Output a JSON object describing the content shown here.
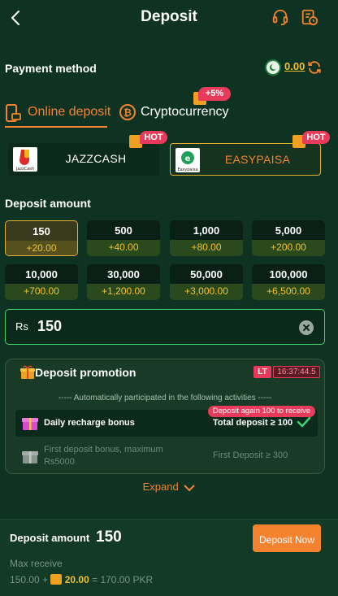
{
  "header": {
    "title": "Deposit",
    "back_icon": "chevron-left-icon",
    "support_icon": "headset-icon",
    "record_icon": "history-icon"
  },
  "payment_method": {
    "label": "Payment method",
    "balance": "0.00",
    "flag_icon": "pakistan-flag-icon",
    "refresh_icon": "refresh-icon"
  },
  "tabs": [
    {
      "label": "Online deposit",
      "icon": "card-phone-icon",
      "active": true
    },
    {
      "label": "Cryptocurrency",
      "icon": "bitcoin-icon",
      "active": false,
      "badge": "+5%"
    }
  ],
  "channels": [
    {
      "name": "JAZZCASH",
      "logo_text": "JazzCash",
      "badge": "HOT",
      "selected": false
    },
    {
      "name": "EASYPAISA",
      "logo_text": "Easypaisa",
      "badge": "HOT",
      "selected": true
    }
  ],
  "deposit_amount": {
    "label": "Deposit amount",
    "options": [
      {
        "amount": "150",
        "bonus": "+20.00",
        "selected": true
      },
      {
        "amount": "500",
        "bonus": "+40.00"
      },
      {
        "amount": "1,000",
        "bonus": "+80.00"
      },
      {
        "amount": "5,000",
        "bonus": "+200.00"
      },
      {
        "amount": "10,000",
        "bonus": "+700.00"
      },
      {
        "amount": "30,000",
        "bonus": "+1,200.00"
      },
      {
        "amount": "50,000",
        "bonus": "+3,000.00"
      },
      {
        "amount": "100,000",
        "bonus": "+6,500.00"
      }
    ],
    "currency_prefix": "Rs",
    "input_value": "150"
  },
  "promotion": {
    "title": "Deposit promotion",
    "lt_badge": "LT",
    "timer": "16:37:44.5",
    "auto_text": "----- Automatically participated in the following activities -----",
    "daily": {
      "label": "Daily recharge bonus",
      "requirement": "Total deposit ≥ 100",
      "tag": "Deposit again 100 to receive"
    },
    "first": {
      "label": "First deposit bonus, maximum Rs5000",
      "requirement": "First Deposit ≥ 300"
    },
    "expand_label": "Expand"
  },
  "footer": {
    "deposit_amount_label": "Deposit amount",
    "deposit_amount_value": "150",
    "button_label": "Deposit Now",
    "max_receive_label": "Max receive",
    "calc_base": "150.00 +",
    "calc_bonus": "20.00",
    "calc_result": "= 170.00 PKR"
  },
  "colors": {
    "background": "#0f3323",
    "accent": "#f5822e",
    "gold": "#f2c12e",
    "hot": "#e83a5a",
    "input_border": "#3fd46c"
  }
}
